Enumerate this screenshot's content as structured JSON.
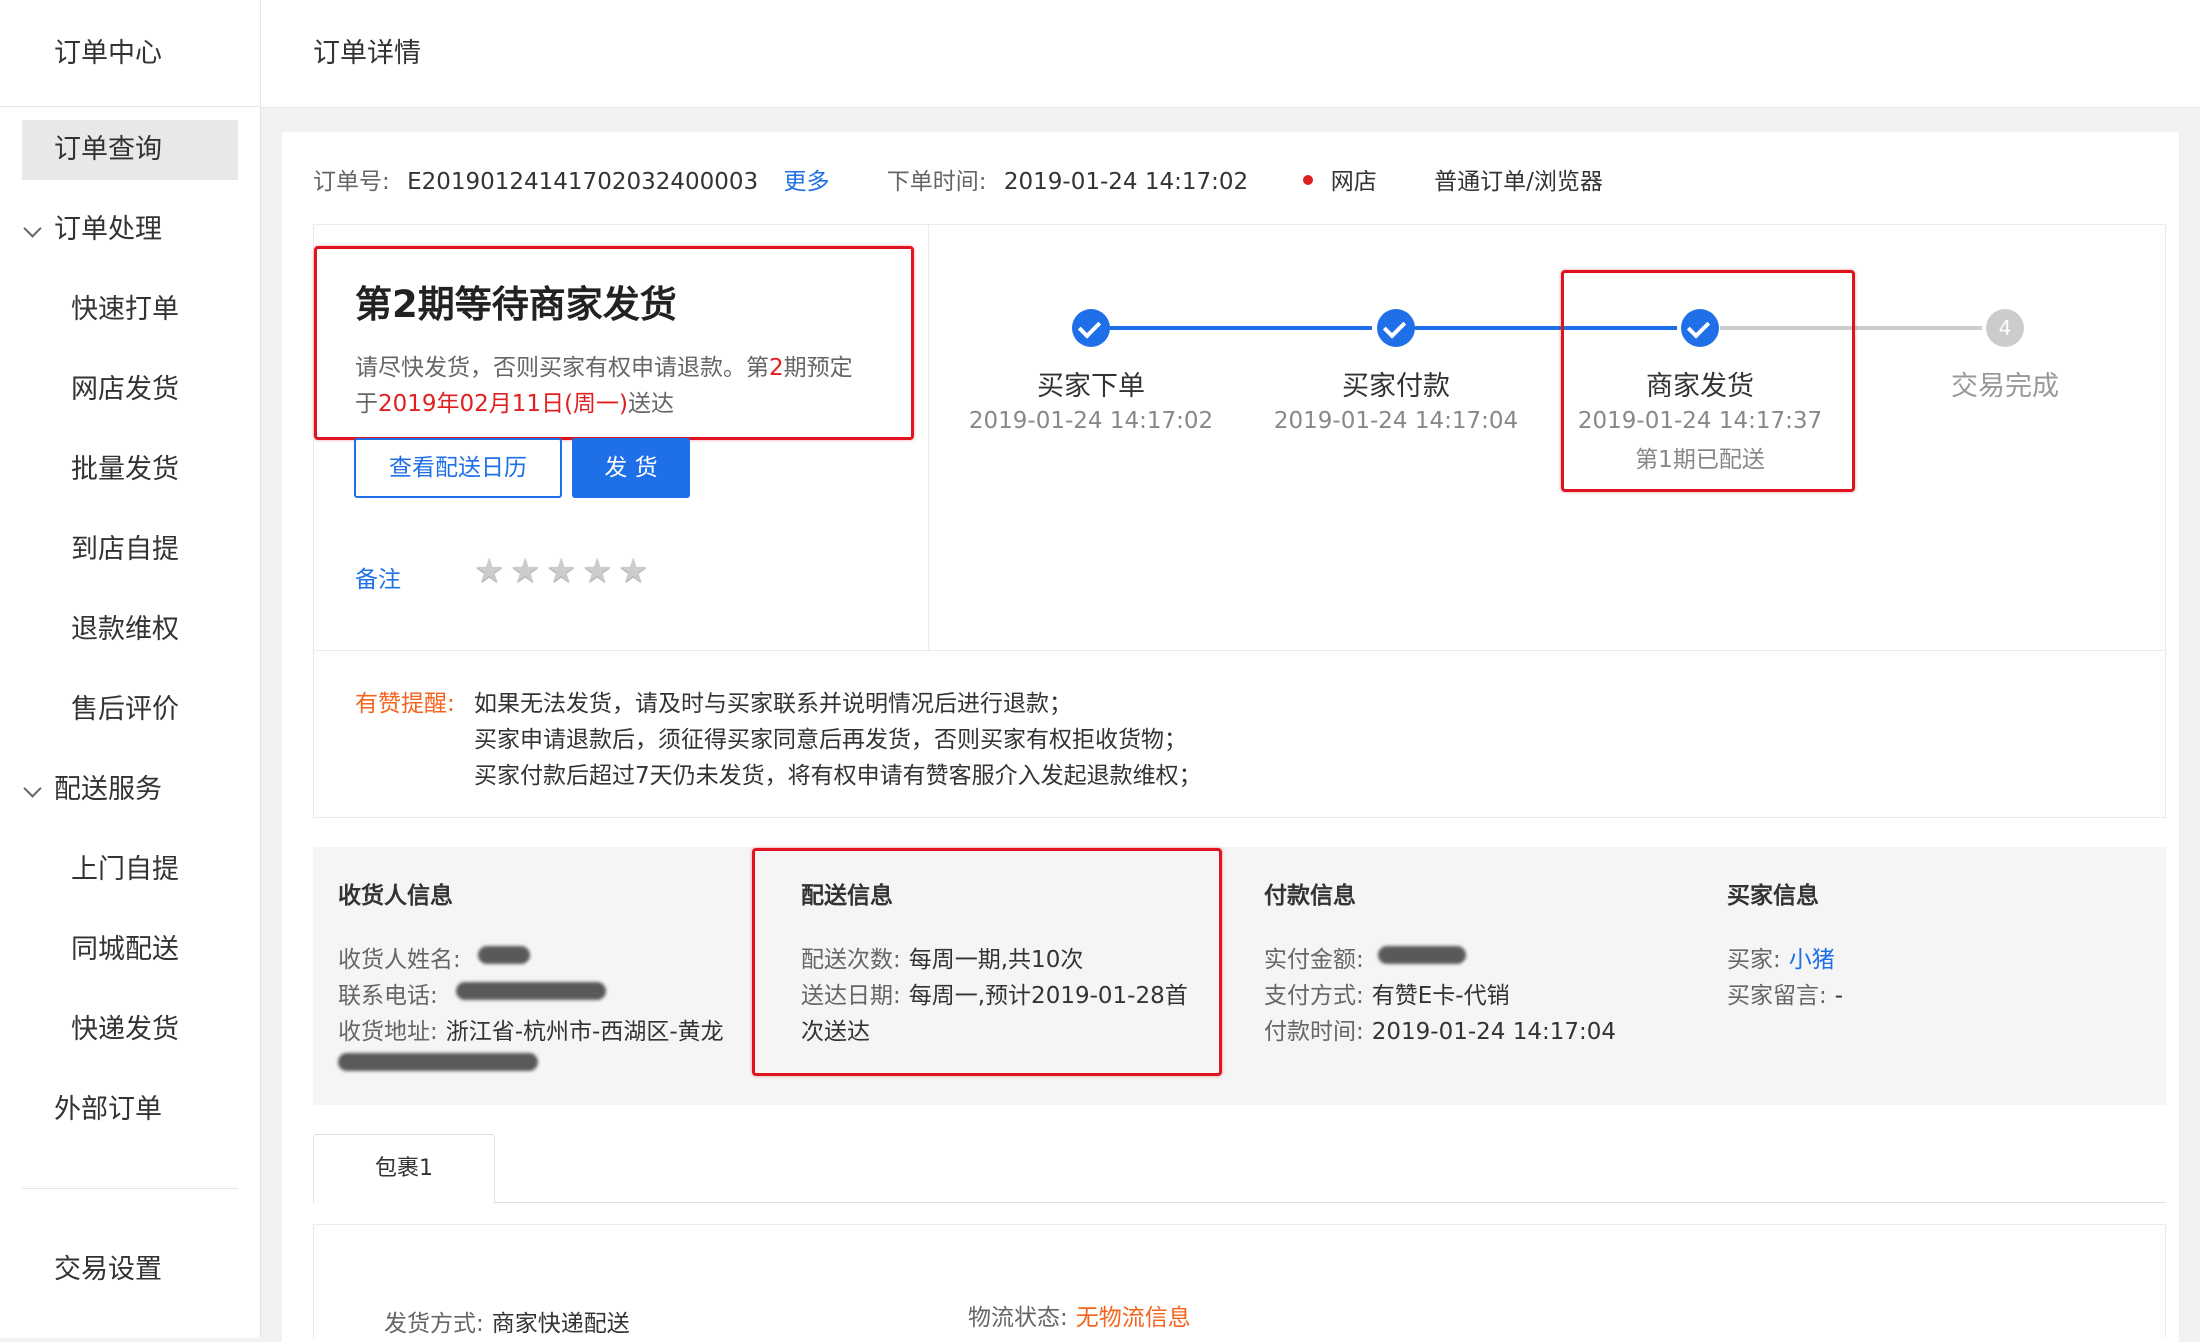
{
  "sidebar": {
    "title": "订单中心",
    "items": [
      {
        "label": "订单查询"
      },
      {
        "label": "订单处理"
      },
      {
        "label": "快速打单"
      },
      {
        "label": "网店发货"
      },
      {
        "label": "批量发货"
      },
      {
        "label": "到店自提"
      },
      {
        "label": "退款维权"
      },
      {
        "label": "售后评价"
      },
      {
        "label": "配送服务"
      },
      {
        "label": "上门自提"
      },
      {
        "label": "同城配送"
      },
      {
        "label": "快递发货"
      },
      {
        "label": "外部订单"
      },
      {
        "label": "交易设置"
      }
    ]
  },
  "header": {
    "title": "订单详情"
  },
  "order": {
    "no_label": "订单号:",
    "no_value": "E20190124141702032400003",
    "more_link": "更多",
    "time_label": "下单时间:",
    "time_value": "2019-01-24 14:17:02",
    "channel": "网店",
    "type": "普通订单/浏览器",
    "channel_dot_color": "#e02020"
  },
  "status": {
    "title_pre": "第",
    "title_num": "2",
    "title_post": "期等待商家发货",
    "desc_1": "请尽快发货，否则买家有权申请退款。第",
    "desc_num": "2",
    "desc_2": "期预定",
    "desc_3": "于",
    "desc_date": "2019年02月11日(周一)",
    "desc_4": "送达",
    "btn_calendar": "查看配送日历",
    "btn_ship": "发 货",
    "remark_link": "备注",
    "stars": 0
  },
  "steps": [
    {
      "label": "买家下单",
      "time": "2019-01-24 14:17:02",
      "done": true
    },
    {
      "label": "买家付款",
      "time": "2019-01-24 14:17:04",
      "done": true
    },
    {
      "label": "商家发货",
      "time": "2019-01-24 14:17:37",
      "sub": "第1期已配送",
      "done": true
    },
    {
      "label": "交易完成",
      "number": "4",
      "done": false
    }
  ],
  "reminder": {
    "label": "有赞提醒:",
    "lines": [
      "如果无法发货，请及时与买家联系并说明情况后进行退款；",
      "买家申请退款后，须征得买家同意后再发货，否则买家有权拒收货物；",
      "买家付款后超过7天仍未发货，将有权申请有赞客服介入发起退款维权；"
    ]
  },
  "info": {
    "receiver": {
      "title": "收货人信息",
      "name_label": "收货人姓名:",
      "phone_label": "联系电话:",
      "address_label": "收货地址:",
      "address_value": "浙江省-杭州市-西湖区-黄龙"
    },
    "delivery": {
      "title": "配送信息",
      "count_label": "配送次数:",
      "count_value": "每周一期,共10次",
      "date_label": "送达日期:",
      "date_value_1": "每周一,预计2019-01-28首",
      "date_value_2": "次送达"
    },
    "payment": {
      "title": "付款信息",
      "amount_label": "实付金额:",
      "method_label": "支付方式:",
      "method_value": "有赞E卡-代销",
      "time_label": "付款时间:",
      "time_value": "2019-01-24 14:17:04"
    },
    "buyer": {
      "title": "买家信息",
      "buyer_label": "买家:",
      "buyer_value": "小猪",
      "message_label": "买家留言:",
      "message_value": "-"
    }
  },
  "package": {
    "tab": "包裹1",
    "ship_method_label": "发货方式:",
    "ship_method_value": "商家快递配送",
    "logistics_label": "物流状态:",
    "logistics_value": "无物流信息"
  },
  "colors": {
    "accent": "#1e6fe8",
    "warning": "#f5641e",
    "highlight": "#e0141e"
  }
}
